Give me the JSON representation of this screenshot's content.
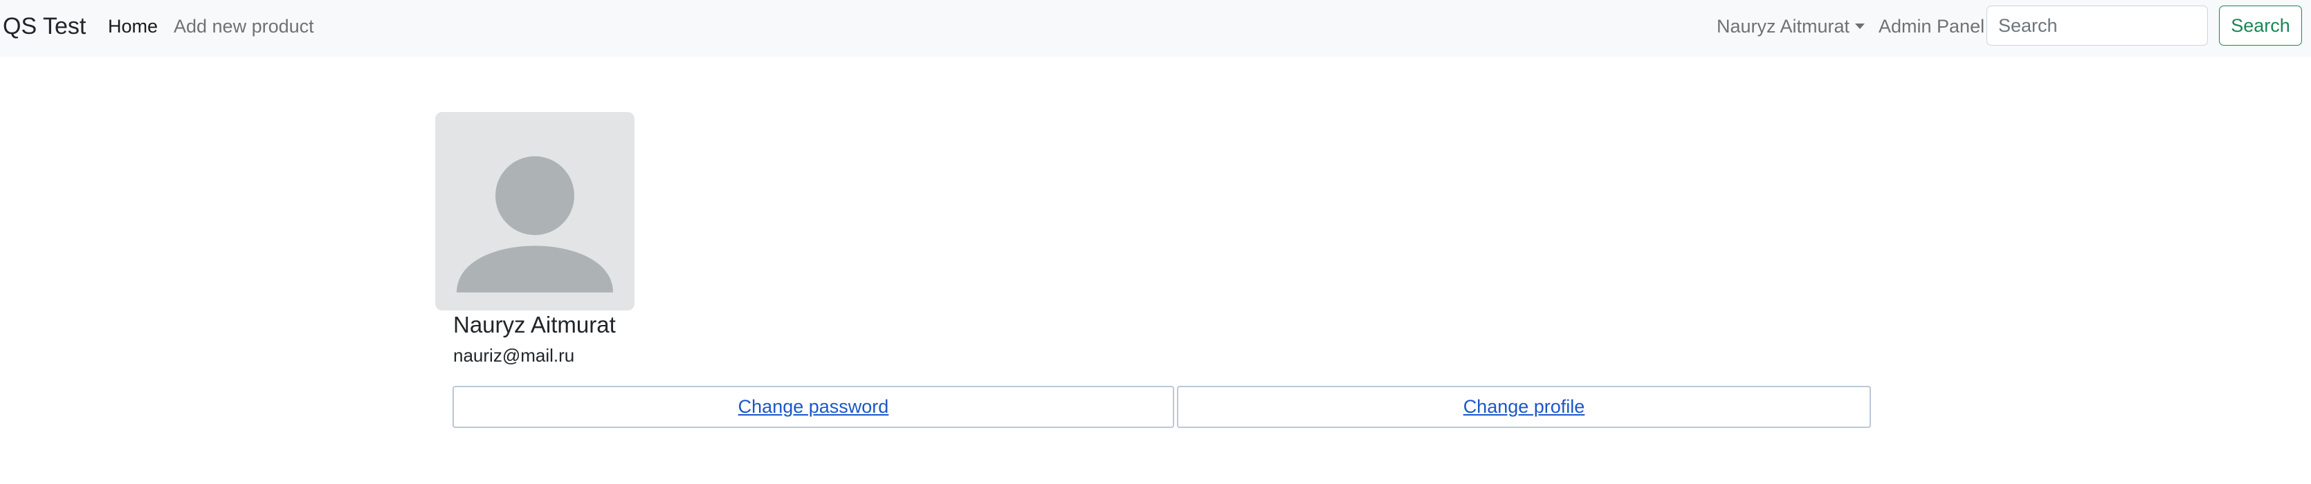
{
  "navbar": {
    "brand": "QS Test",
    "links": [
      {
        "label": "Home",
        "active": true
      },
      {
        "label": "Add new product",
        "active": false
      }
    ],
    "user_menu_label": "Nauryz Aitmurat",
    "admin_link_label": "Admin Panel",
    "search": {
      "placeholder": "Search",
      "value": ""
    },
    "search_button_label": "Search"
  },
  "profile": {
    "avatar_icon": "default-user-avatar-icon",
    "name": "Nauryz Aitmurat",
    "email": "nauriz@mail.ru"
  },
  "actions": {
    "change_password_label": "Change password",
    "change_profile_label": "Change profile"
  },
  "colors": {
    "navbar_bg": "#f8f9fa",
    "success": "#198754",
    "link": "#1a57c8",
    "avatar_bg": "#e3e4e6",
    "avatar_fg": "#adb3b5"
  }
}
